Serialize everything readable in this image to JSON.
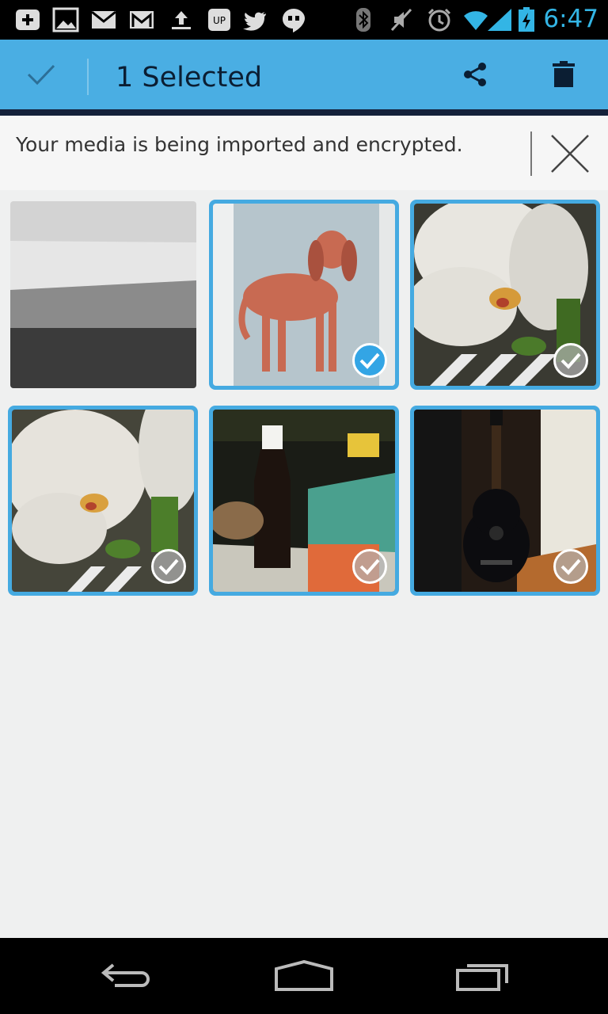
{
  "status_bar": {
    "time": "6:47",
    "icons": [
      "add-icon",
      "image-icon",
      "mail-icon",
      "gmail-icon",
      "upload-icon",
      "voicemail-icon",
      "twitter-icon",
      "hangouts-icon",
      "bluetooth-icon",
      "mute-icon",
      "alarm-icon",
      "wifi-icon",
      "signal-icon",
      "battery-charging-icon"
    ]
  },
  "action_bar": {
    "title": "1 Selected",
    "accent": "#4aaee3",
    "done_icon": "check-icon",
    "share_icon": "share-icon",
    "delete_icon": "trash-icon"
  },
  "banner": {
    "text": "Your media is being imported and encrypted.",
    "close_icon": "close-icon"
  },
  "media": [
    {
      "thumb": "placeholder-stripes",
      "selected": false,
      "checked": false
    },
    {
      "thumb": "dachshund-poster",
      "selected": true,
      "checked": true
    },
    {
      "thumb": "orchid-1",
      "selected": true,
      "checked": false
    },
    {
      "thumb": "orchid-2",
      "selected": true,
      "checked": false
    },
    {
      "thumb": "bottle",
      "selected": true,
      "checked": false
    },
    {
      "thumb": "guitar",
      "selected": true,
      "checked": false
    }
  ],
  "nav_bar": {
    "back_icon": "back-icon",
    "home_icon": "home-icon",
    "recents_icon": "recents-icon"
  }
}
